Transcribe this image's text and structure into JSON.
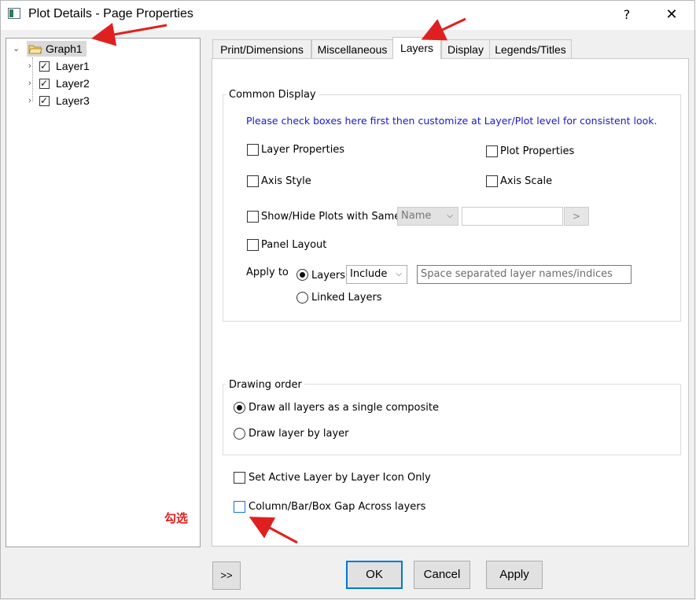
{
  "window": {
    "title": "Plot Details - Page Properties",
    "help_label": "?",
    "close_label": "✕"
  },
  "tree": {
    "root": {
      "label": "Graph1",
      "expanded": true,
      "selected": true
    },
    "layers": [
      {
        "label": "Layer1",
        "checked": true
      },
      {
        "label": "Layer2",
        "checked": true
      },
      {
        "label": "Layer3",
        "checked": true
      }
    ]
  },
  "tabs": [
    {
      "label": "Print/Dimensions",
      "active": false
    },
    {
      "label": "Miscellaneous",
      "active": false
    },
    {
      "label": "Layers",
      "active": true
    },
    {
      "label": "Display",
      "active": false
    },
    {
      "label": "Legends/Titles",
      "active": false
    }
  ],
  "common_display": {
    "title": "Common Display",
    "info": "Please check boxes here first then customize at Layer/Plot level for consistent look.",
    "layer_properties": {
      "label": "Layer Properties",
      "checked": false
    },
    "plot_properties": {
      "label": "Plot Properties",
      "checked": false
    },
    "axis_style": {
      "label": "Axis Style",
      "checked": false
    },
    "axis_scale": {
      "label": "Axis Scale",
      "checked": false
    },
    "show_hide_plots": {
      "label": "Show/Hide Plots with Same",
      "checked": false
    },
    "same_combo": {
      "value": "Name"
    },
    "same_value": {
      "value": ""
    },
    "same_button_label": ">",
    "panel_layout": {
      "label": "Panel Layout",
      "checked": false
    },
    "apply_to_label": "Apply to",
    "radio_layers": {
      "label": "Layers",
      "selected": true
    },
    "include_combo": {
      "value": "Include"
    },
    "layer_names": {
      "value": "",
      "placeholder": "Space separated layer names/indices"
    },
    "radio_linked": {
      "label": "Linked Layers",
      "selected": false
    }
  },
  "drawing_order": {
    "title": "Drawing order",
    "single_composite": {
      "label": "Draw all layers as a single composite",
      "selected": true
    },
    "layer_by_layer": {
      "label": "Draw layer by layer",
      "selected": false
    }
  },
  "options": {
    "set_active_layer": {
      "label": "Set Active Layer by Layer Icon Only",
      "checked": false
    },
    "column_gap": {
      "label": "Column/Bar/Box Gap Across layers",
      "checked": false
    }
  },
  "annotation": {
    "text": "勾选",
    "color": "#e02020"
  },
  "buttons": {
    "expand": ">>",
    "ok": "OK",
    "cancel": "Cancel",
    "apply": "Apply"
  },
  "colors": {
    "accent": "#0078d7",
    "info_text": "#1a1ac8",
    "annotation": "#e02020"
  }
}
